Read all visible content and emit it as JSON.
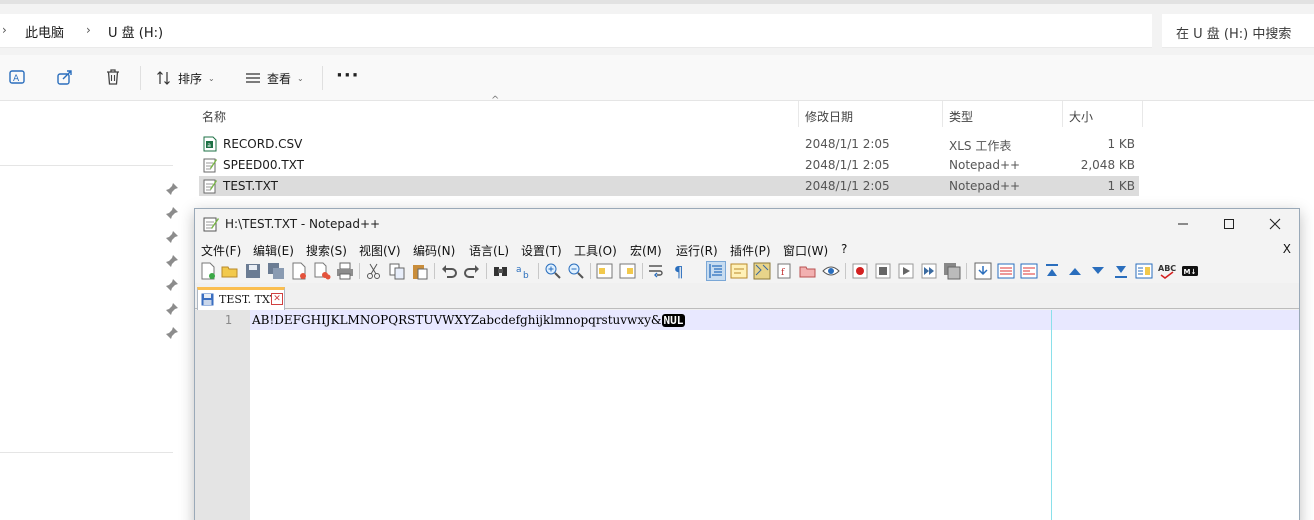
{
  "explorer": {
    "breadcrumb": [
      "此电脑",
      "U 盘 (H:)"
    ],
    "search_placeholder": "在 U 盘 (H:) 中搜索",
    "commands": {
      "sort_label": "排序",
      "view_label": "查看",
      "more_label": "···"
    },
    "columns": {
      "name": "名称",
      "date": "修改日期",
      "type": "类型",
      "size": "大小"
    },
    "files": [
      {
        "name": "RECORD.CSV",
        "date": "2048/1/1 2:05",
        "type": "XLS 工作表",
        "size": "1 KB",
        "icon": "excel-csv-icon"
      },
      {
        "name": "SPEED00.TXT",
        "date": "2048/1/1 2:05",
        "type": "Notepad++",
        "size": "2,048 KB",
        "icon": "notepad-file-icon"
      },
      {
        "name": "TEST.TXT",
        "date": "2048/1/1 2:05",
        "type": "Notepad++",
        "size": "1 KB",
        "icon": "notepad-file-icon",
        "selected": true
      }
    ]
  },
  "notepad": {
    "title": "H:\\TEST.TXT - Notepad++",
    "menu": [
      "文件(F)",
      "编辑(E)",
      "搜索(S)",
      "视图(V)",
      "编码(N)",
      "语言(L)",
      "设置(T)",
      "工具(O)",
      "宏(M)",
      "运行(R)",
      "插件(P)",
      "窗口(W)",
      "?"
    ],
    "menu_close": "X",
    "tab_label": "TEST. TXT",
    "line_number": "1",
    "line_text": "AB!DEFGHIJKLMNOPQRSTUVWXYZabcdefghijklmnopqrstuvwxy&",
    "nul_token": "NUL"
  },
  "colors": {
    "selection": "#dcdcdc",
    "current_line": "#e8e8ff",
    "edge_line": "#8ae0ea",
    "tab_accent": "#fabe50"
  }
}
